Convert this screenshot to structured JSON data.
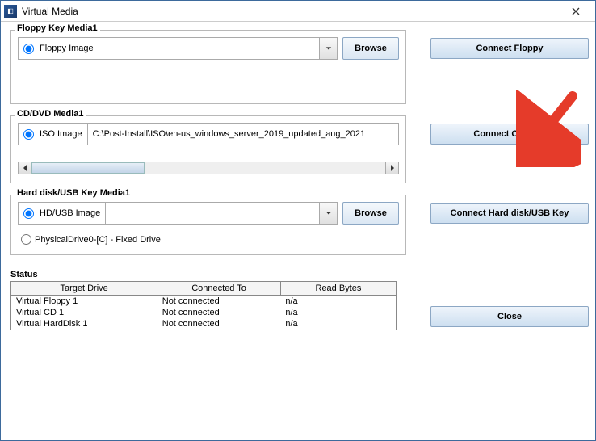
{
  "window": {
    "title": "Virtual Media"
  },
  "floppy": {
    "legend": "Floppy Key Media1",
    "radio_label": "Floppy Image",
    "value": "",
    "browse": "Browse",
    "connect": "Connect Floppy"
  },
  "cddvd": {
    "legend": "CD/DVD Media1",
    "radio_label": "ISO Image",
    "value": "C:\\Post-Install\\ISO\\en-us_windows_server_2019_updated_aug_2021",
    "connect": "Connect CD/DVD"
  },
  "hdusb": {
    "legend": "Hard disk/USB Key Media1",
    "radio_label": "HD/USB Image",
    "value": "",
    "browse": "Browse",
    "connect": "Connect Hard disk/USB Key",
    "physical_label": "PhysicalDrive0-[C] - Fixed Drive"
  },
  "status": {
    "legend": "Status",
    "headers": [
      "Target Drive",
      "Connected To",
      "Read Bytes"
    ],
    "rows": [
      [
        "Virtual Floppy 1",
        "Not connected",
        "n/a"
      ],
      [
        "Virtual CD 1",
        "Not connected",
        "n/a"
      ],
      [
        "Virtual HardDisk 1",
        "Not connected",
        "n/a"
      ]
    ]
  },
  "close": "Close"
}
